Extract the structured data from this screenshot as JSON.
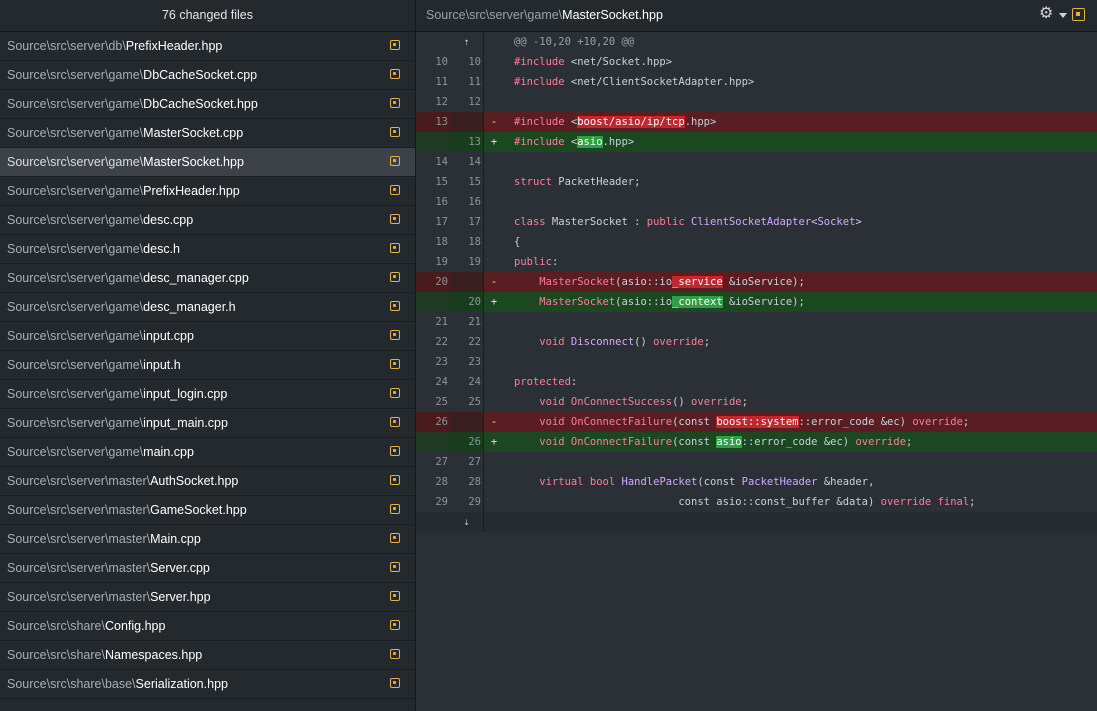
{
  "sidebar": {
    "title": "76 changed files",
    "files": [
      {
        "dir": "Source\\src\\server\\db\\",
        "name": "PrefixHeader.hpp"
      },
      {
        "dir": "Source\\src\\server\\game\\",
        "name": "DbCacheSocket.cpp"
      },
      {
        "dir": "Source\\src\\server\\game\\",
        "name": "DbCacheSocket.hpp"
      },
      {
        "dir": "Source\\src\\server\\game\\",
        "name": "MasterSocket.cpp"
      },
      {
        "dir": "Source\\src\\server\\game\\",
        "name": "MasterSocket.hpp",
        "selected": true
      },
      {
        "dir": "Source\\src\\server\\game\\",
        "name": "PrefixHeader.hpp"
      },
      {
        "dir": "Source\\src\\server\\game\\",
        "name": "desc.cpp"
      },
      {
        "dir": "Source\\src\\server\\game\\",
        "name": "desc.h"
      },
      {
        "dir": "Source\\src\\server\\game\\",
        "name": "desc_manager.cpp"
      },
      {
        "dir": "Source\\src\\server\\game\\",
        "name": "desc_manager.h"
      },
      {
        "dir": "Source\\src\\server\\game\\",
        "name": "input.cpp"
      },
      {
        "dir": "Source\\src\\server\\game\\",
        "name": "input.h"
      },
      {
        "dir": "Source\\src\\server\\game\\",
        "name": "input_login.cpp"
      },
      {
        "dir": "Source\\src\\server\\game\\",
        "name": "input_main.cpp"
      },
      {
        "dir": "Source\\src\\server\\game\\",
        "name": "main.cpp"
      },
      {
        "dir": "Source\\src\\server\\master\\",
        "name": "AuthSocket.hpp"
      },
      {
        "dir": "Source\\src\\server\\master\\",
        "name": "GameSocket.hpp"
      },
      {
        "dir": "Source\\src\\server\\master\\",
        "name": "Main.cpp"
      },
      {
        "dir": "Source\\src\\server\\master\\",
        "name": "Server.cpp"
      },
      {
        "dir": "Source\\src\\server\\master\\",
        "name": "Server.hpp"
      },
      {
        "dir": "Source\\src\\share\\",
        "name": "Config.hpp"
      },
      {
        "dir": "Source\\src\\share\\",
        "name": "Namespaces.hpp"
      },
      {
        "dir": "Source\\src\\share\\base\\",
        "name": "Serialization.hpp"
      }
    ]
  },
  "header": {
    "path_dir": "Source\\src\\server\\game\\",
    "path_file": "MasterSocket.hpp"
  },
  "diff": {
    "hunk_header": "@@ -10,20 +10,20 @@",
    "expand_up_icon": "⇡",
    "expand_down_icon": "⇣",
    "lines": [
      {
        "type": "ctx",
        "old": "10",
        "new": "10",
        "sign": "",
        "parts": [
          [
            "pre",
            "#include "
          ],
          [
            "",
            "<net/Socket.hpp>"
          ]
        ]
      },
      {
        "type": "ctx",
        "old": "11",
        "new": "11",
        "sign": "",
        "parts": [
          [
            "pre",
            "#include "
          ],
          [
            "",
            "<net/ClientSocketAdapter.hpp>"
          ]
        ]
      },
      {
        "type": "ctx",
        "old": "12",
        "new": "12",
        "sign": "",
        "parts": []
      },
      {
        "type": "del",
        "old": "13",
        "new": "",
        "sign": "-",
        "parts": [
          [
            "pre",
            "#include "
          ],
          [
            "",
            "<"
          ],
          [
            "hl-del",
            "boost/asio/ip/tcp"
          ],
          [
            "",
            ".hpp>"
          ]
        ]
      },
      {
        "type": "add",
        "old": "",
        "new": "13",
        "sign": "+",
        "parts": [
          [
            "pre",
            "#include "
          ],
          [
            "",
            "<"
          ],
          [
            "hl-add",
            "asio"
          ],
          [
            "",
            ".hpp>"
          ]
        ]
      },
      {
        "type": "ctx",
        "old": "14",
        "new": "14",
        "sign": "",
        "parts": []
      },
      {
        "type": "ctx",
        "old": "15",
        "new": "15",
        "sign": "",
        "parts": [
          [
            "kw",
            "struct"
          ],
          [
            "",
            " PacketHeader;"
          ]
        ]
      },
      {
        "type": "ctx",
        "old": "16",
        "new": "16",
        "sign": "",
        "parts": []
      },
      {
        "type": "ctx",
        "old": "17",
        "new": "17",
        "sign": "",
        "parts": [
          [
            "kw",
            "class"
          ],
          [
            "",
            " MasterSocket : "
          ],
          [
            "kw",
            "public"
          ],
          [
            "",
            " "
          ],
          [
            "ty",
            "ClientSocketAdapter"
          ],
          [
            "",
            "<"
          ],
          [
            "ty",
            "Socket"
          ],
          [
            "",
            ">"
          ]
        ]
      },
      {
        "type": "ctx",
        "old": "18",
        "new": "18",
        "sign": "",
        "parts": [
          [
            "",
            "{"
          ]
        ]
      },
      {
        "type": "ctx",
        "old": "19",
        "new": "19",
        "sign": "",
        "parts": [
          [
            "kw",
            "public"
          ],
          [
            "",
            ":"
          ]
        ]
      },
      {
        "type": "del",
        "old": "20",
        "new": "",
        "sign": "-",
        "parts": [
          [
            "",
            "    "
          ],
          [
            "kw",
            "MasterSocket"
          ],
          [
            "",
            "(asio::io"
          ],
          [
            "hl-del",
            "_service"
          ],
          [
            "",
            " &ioService);"
          ]
        ]
      },
      {
        "type": "add",
        "old": "",
        "new": "20",
        "sign": "+",
        "parts": [
          [
            "",
            "    "
          ],
          [
            "kw",
            "MasterSocket"
          ],
          [
            "",
            "(asio::io"
          ],
          [
            "hl-add",
            "_context"
          ],
          [
            "",
            " &ioService);"
          ]
        ]
      },
      {
        "type": "ctx",
        "old": "21",
        "new": "21",
        "sign": "",
        "parts": []
      },
      {
        "type": "ctx",
        "old": "22",
        "new": "22",
        "sign": "",
        "parts": [
          [
            "",
            "    "
          ],
          [
            "kw",
            "void"
          ],
          [
            "",
            " "
          ],
          [
            "ty",
            "Disconnect"
          ],
          [
            "",
            "() "
          ],
          [
            "kw",
            "override"
          ],
          [
            "",
            ";"
          ]
        ]
      },
      {
        "type": "ctx",
        "old": "23",
        "new": "23",
        "sign": "",
        "parts": []
      },
      {
        "type": "ctx",
        "old": "24",
        "new": "24",
        "sign": "",
        "parts": [
          [
            "kw",
            "protected"
          ],
          [
            "",
            ":"
          ]
        ]
      },
      {
        "type": "ctx",
        "old": "25",
        "new": "25",
        "sign": "",
        "parts": [
          [
            "",
            "    "
          ],
          [
            "kw",
            "void"
          ],
          [
            "",
            " "
          ],
          [
            "kw",
            "OnConnectSuccess"
          ],
          [
            "",
            "() "
          ],
          [
            "kw",
            "override"
          ],
          [
            "",
            ";"
          ]
        ]
      },
      {
        "type": "del",
        "old": "26",
        "new": "",
        "sign": "-",
        "parts": [
          [
            "",
            "    "
          ],
          [
            "kw",
            "void"
          ],
          [
            "",
            " "
          ],
          [
            "kw",
            "OnConnectFailure"
          ],
          [
            "",
            "(const "
          ],
          [
            "hl-del",
            "boost::system"
          ],
          [
            "",
            "::error_code &ec) "
          ],
          [
            "kw",
            "override"
          ],
          [
            "",
            ";"
          ]
        ]
      },
      {
        "type": "add",
        "old": "",
        "new": "26",
        "sign": "+",
        "parts": [
          [
            "",
            "    "
          ],
          [
            "kw",
            "void"
          ],
          [
            "",
            " "
          ],
          [
            "kw",
            "OnConnectFailure"
          ],
          [
            "",
            "(const "
          ],
          [
            "hl-add",
            "asio"
          ],
          [
            "",
            "::error_code &ec) "
          ],
          [
            "kw",
            "override"
          ],
          [
            "",
            ";"
          ]
        ]
      },
      {
        "type": "ctx",
        "old": "27",
        "new": "27",
        "sign": "",
        "parts": []
      },
      {
        "type": "ctx",
        "old": "28",
        "new": "28",
        "sign": "",
        "parts": [
          [
            "",
            "    "
          ],
          [
            "kw",
            "virtual"
          ],
          [
            "",
            " "
          ],
          [
            "kw",
            "bool"
          ],
          [
            "",
            " "
          ],
          [
            "ty",
            "HandlePacket"
          ],
          [
            "",
            "(const "
          ],
          [
            "ty",
            "PacketHeader"
          ],
          [
            "",
            " &header,"
          ]
        ]
      },
      {
        "type": "ctx",
        "old": "29",
        "new": "29",
        "sign": "",
        "parts": [
          [
            "",
            "                          const asio::const_buffer &data) "
          ],
          [
            "kw",
            "override"
          ],
          [
            "",
            " "
          ],
          [
            "kw",
            "final"
          ],
          [
            "",
            ";"
          ]
        ]
      }
    ]
  },
  "colors": {
    "modified": "#e3b341",
    "deleted_bg": "#5a1e22",
    "added_bg": "#1b4721"
  }
}
